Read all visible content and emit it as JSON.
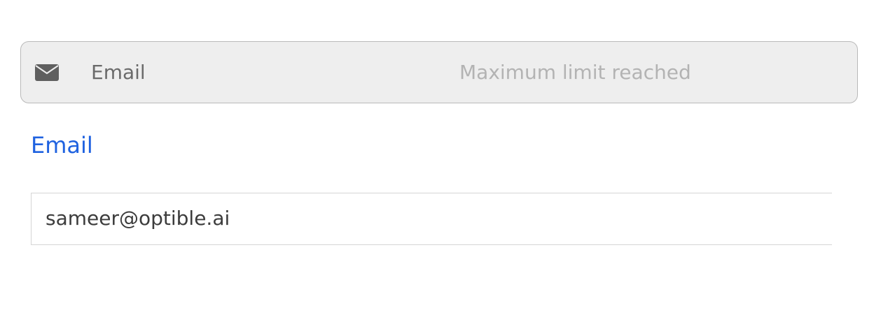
{
  "add_email_bar": {
    "icon": "envelope-icon",
    "label": "Email",
    "status": "Maximum limit reached"
  },
  "email_section": {
    "label": "Email",
    "value": "sameer@optible.ai"
  },
  "colors": {
    "accent": "#1f62e0",
    "bar_background": "#eeeeee",
    "bar_border": "#b9b9b9",
    "muted_text": "#b3b3b3",
    "icon": "#5f5f5f"
  }
}
